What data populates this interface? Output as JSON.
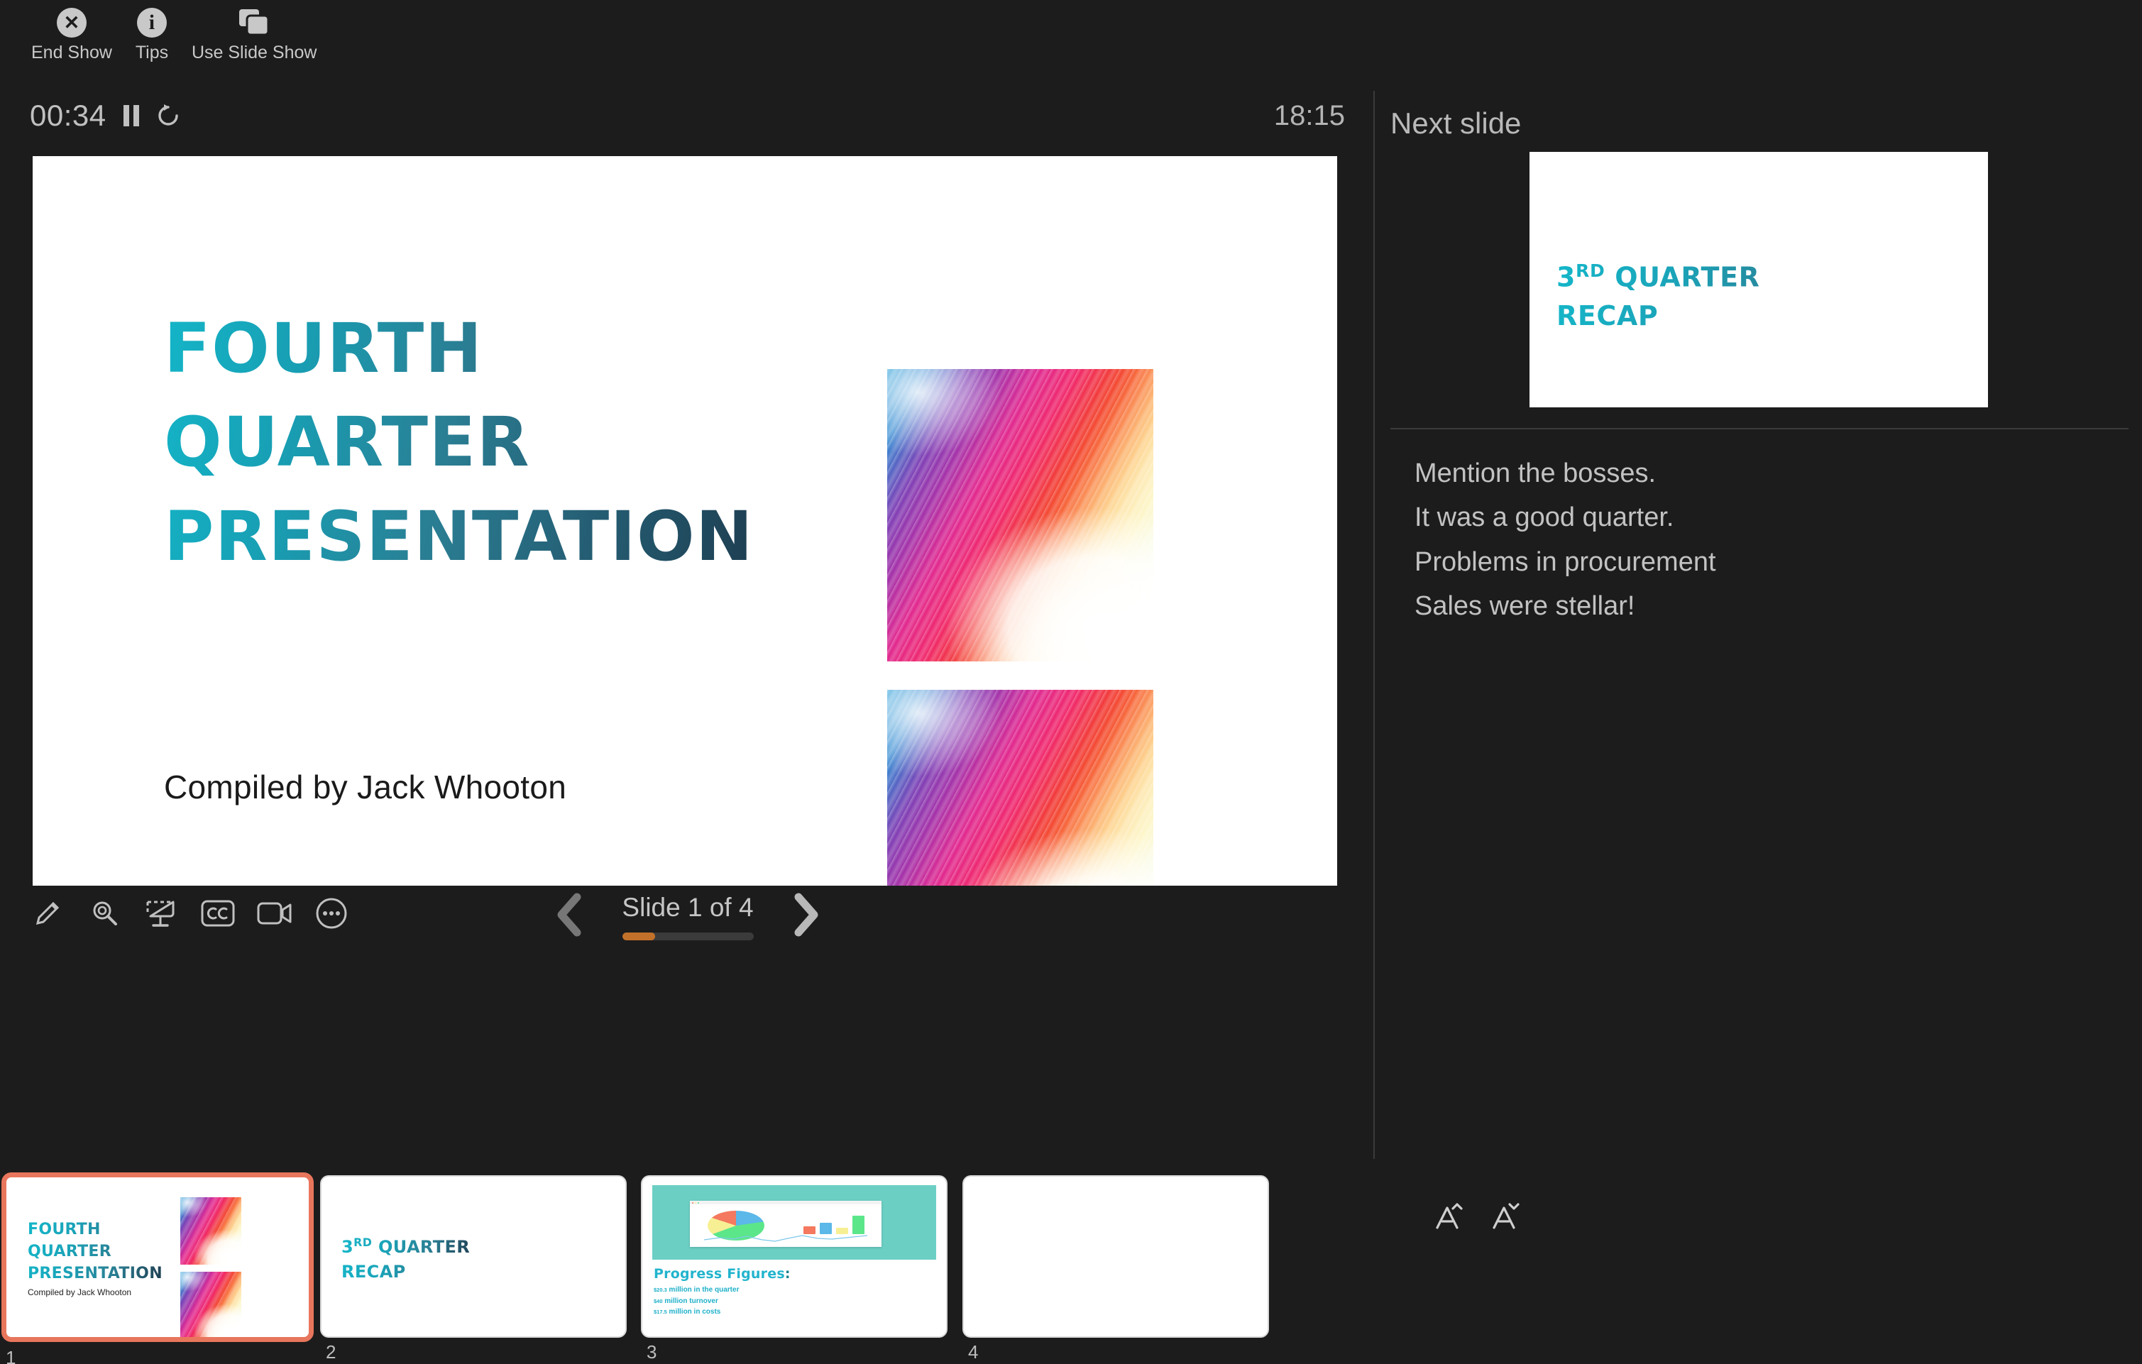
{
  "toolbar": {
    "items": [
      {
        "label": "End Show",
        "icon": "close-circle-icon",
        "glyph": "✕"
      },
      {
        "label": "Tips",
        "icon": "info-circle-icon",
        "glyph": "i"
      },
      {
        "label": "Use Slide Show",
        "icon": "slide-stack-icon",
        "glyph": ""
      }
    ]
  },
  "timer": {
    "elapsed": "00:34",
    "clock": "18:15",
    "pause_icon": "pause-icon",
    "reset_icon": "reset-icon"
  },
  "current_slide": {
    "title_lines": [
      "FOURTH",
      "QUARTER",
      "PRESENTATION"
    ],
    "subtitle": "Compiled by Jack Whooton"
  },
  "controls": {
    "tools": [
      {
        "name": "pen-icon",
        "label": "Draw"
      },
      {
        "name": "magnifier-icon",
        "label": "Zoom"
      },
      {
        "name": "presenter-display-icon",
        "label": "Presenter Display"
      },
      {
        "name": "closed-captions-icon",
        "label": "CC"
      },
      {
        "name": "video-camera-icon",
        "label": "Record Video"
      },
      {
        "name": "more-ellipsis-icon",
        "label": "More"
      }
    ],
    "counter": "Slide 1 of 4",
    "progress_percent": 25,
    "progress_color": "#c2712a",
    "prev_icon": "chevron-left-icon",
    "next_icon": "chevron-right-icon"
  },
  "sidebar": {
    "next_slide_label": "Next slide",
    "next_slide_title_prefix": "3",
    "next_slide_title_sup": "RD",
    "next_slide_title_rest": " QUARTER",
    "next_slide_title_line2": "RECAP",
    "notes": [
      "Mention the bosses.",
      "It was a good quarter.",
      "Problems in procurement",
      "Sales were stellar!"
    ],
    "note_size_increase": "Aˆ",
    "note_size_decrease": "Aˇ"
  },
  "thumbnails": [
    {
      "number": "1",
      "selected": true,
      "title_lines": [
        "FOURTH",
        "QUARTER",
        "PRESENTATION"
      ],
      "subtitle": "Compiled by Jack Whooton"
    },
    {
      "number": "2",
      "selected": false,
      "title_prefix": "3",
      "title_sup": "RD",
      "title_rest": " QUARTER",
      "title_line2": "RECAP"
    },
    {
      "number": "3",
      "selected": false,
      "heading": "Progress Figures",
      "heading_colon": ":",
      "figures": [
        {
          "amount": "$20.3",
          "text": " million in the quarter"
        },
        {
          "amount": "$40",
          "text": " million turnover"
        },
        {
          "amount": "$17.5",
          "text": " million in costs"
        }
      ]
    },
    {
      "number": "4",
      "selected": false
    }
  ],
  "colors": {
    "background": "#1c1c1c",
    "accent_teal": "#15b6c9",
    "accent_dark_teal": "#1f3e51",
    "selection_orange": "#e8765c",
    "progress_orange": "#c2712a",
    "text_grey": "#c2c2c2"
  }
}
